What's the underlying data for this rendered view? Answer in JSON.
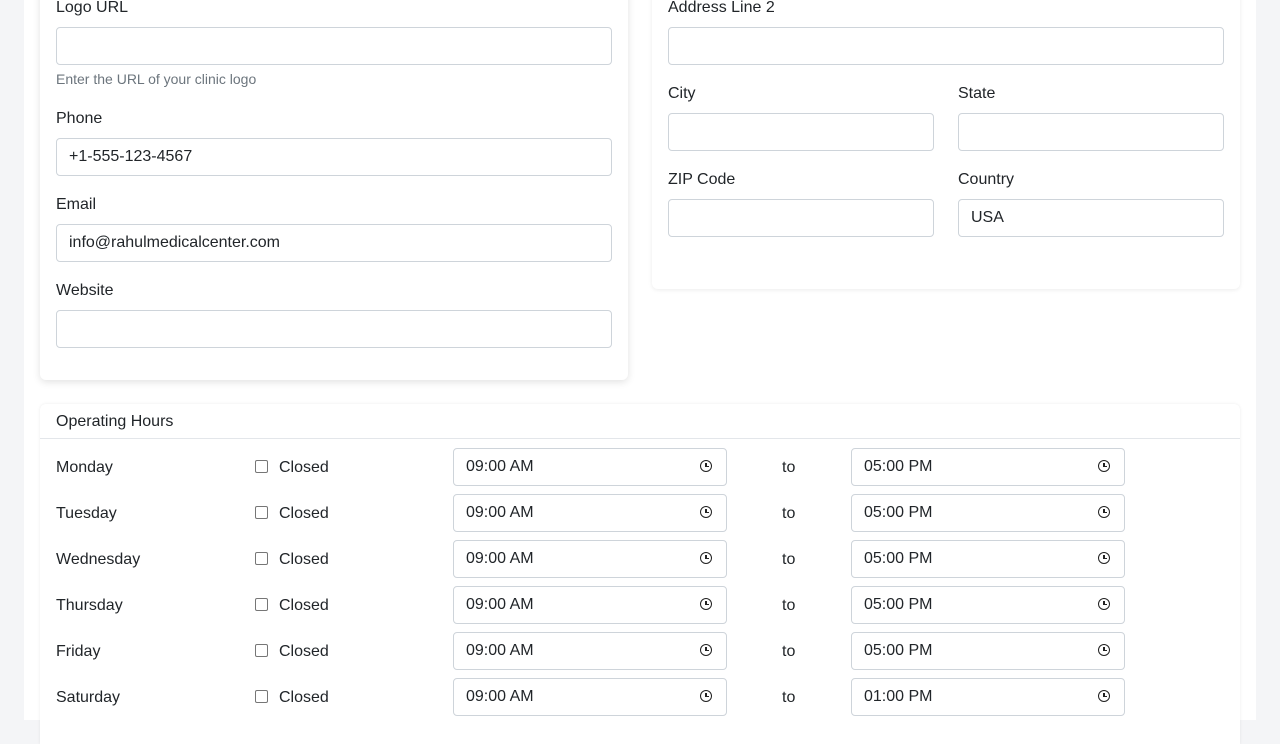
{
  "clinic_info": {
    "logo_url": {
      "label": "Logo URL",
      "value": "",
      "help": "Enter the URL of your clinic logo"
    },
    "phone": {
      "label": "Phone",
      "value": "+1-555-123-4567"
    },
    "email": {
      "label": "Email",
      "value": "info@rahulmedicalcenter.com"
    },
    "website": {
      "label": "Website",
      "value": ""
    }
  },
  "address": {
    "address_line_2": {
      "label": "Address Line 2",
      "value": ""
    },
    "city": {
      "label": "City",
      "value": ""
    },
    "state": {
      "label": "State",
      "value": ""
    },
    "zip": {
      "label": "ZIP Code",
      "value": ""
    },
    "country": {
      "label": "Country",
      "value": "USA"
    }
  },
  "operating_hours": {
    "title": "Operating Hours",
    "closed_label": "Closed",
    "to_label": "to",
    "days": [
      {
        "day": "Monday",
        "closed": false,
        "open": "09:00 AM",
        "close": "05:00 PM"
      },
      {
        "day": "Tuesday",
        "closed": false,
        "open": "09:00 AM",
        "close": "05:00 PM"
      },
      {
        "day": "Wednesday",
        "closed": false,
        "open": "09:00 AM",
        "close": "05:00 PM"
      },
      {
        "day": "Thursday",
        "closed": false,
        "open": "09:00 AM",
        "close": "05:00 PM"
      },
      {
        "day": "Friday",
        "closed": false,
        "open": "09:00 AM",
        "close": "05:00 PM"
      },
      {
        "day": "Saturday",
        "closed": false,
        "open": "09:00 AM",
        "close": "01:00 PM"
      }
    ]
  }
}
